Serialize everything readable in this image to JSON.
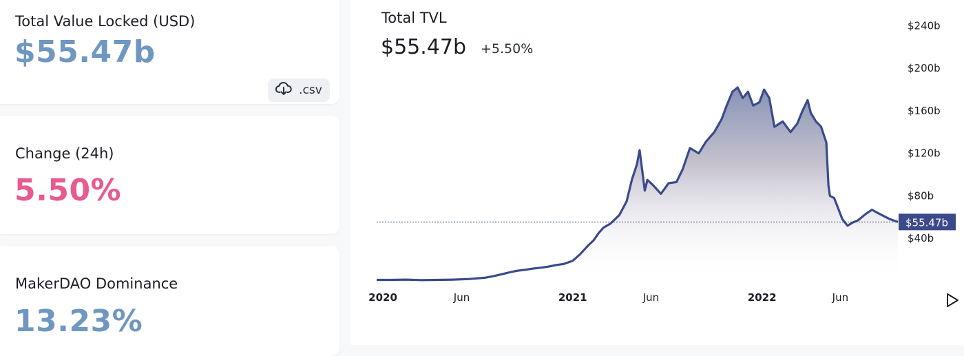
{
  "stats": [
    {
      "label": "Total Value Locked (USD)",
      "value": "$55.47b"
    },
    {
      "label": "Change (24h)",
      "value": "5.50%"
    },
    {
      "label": "MakerDAO Dominance",
      "value": "13.23%"
    }
  ],
  "csv_button": {
    "label": ".csv",
    "icon": "cloud-download-icon"
  },
  "header": {
    "title": "Total TVL",
    "value": "$55.47b",
    "change": "+5.50%"
  },
  "colors": {
    "line": "#3b4a8a",
    "accent_blue": "#6f98c0",
    "accent_pink": "#e85a92",
    "current_tag_bg": "#3b4a8a"
  },
  "chart_data": {
    "type": "area",
    "title": "Total TVL",
    "ylim": [
      0,
      250
    ],
    "y_unit": "billions USD",
    "y_ticks": [
      40,
      80,
      120,
      160,
      200,
      240
    ],
    "y_tick_labels": [
      "$40b",
      "$80b",
      "$120b",
      "$160b",
      "$200b",
      "$240b"
    ],
    "x_ticks": [
      "2020-01-01",
      "2020-06-01",
      "2021-01-01",
      "2021-06-01",
      "2022-01-01",
      "2022-06-01"
    ],
    "x_tick_labels": [
      "2020",
      "Jun",
      "2021",
      "Jun",
      "2022",
      "Jun"
    ],
    "xlim": [
      "2019-12-20",
      "2022-09-20"
    ],
    "current": {
      "value": 55.47,
      "label": "$55.47b"
    },
    "grid": false,
    "series": [
      {
        "x": [
          "2019-12-20",
          "2020-01-15",
          "2020-02-15",
          "2020-03-15",
          "2020-04-15",
          "2020-05-15",
          "2020-06-15",
          "2020-07-15",
          "2020-08-01",
          "2020-08-15",
          "2020-09-01",
          "2020-09-15",
          "2020-10-01",
          "2020-10-15",
          "2020-11-01",
          "2020-11-15",
          "2020-12-01",
          "2020-12-15",
          "2021-01-01",
          "2021-01-15",
          "2021-02-01",
          "2021-02-10",
          "2021-02-20",
          "2021-03-01",
          "2021-03-15",
          "2021-04-01",
          "2021-04-15",
          "2021-04-25",
          "2021-05-05",
          "2021-05-10",
          "2021-05-20",
          "2021-05-25",
          "2021-06-05",
          "2021-06-20",
          "2021-07-05",
          "2021-07-20",
          "2021-08-01",
          "2021-08-15",
          "2021-09-01",
          "2021-09-15",
          "2021-10-01",
          "2021-10-15",
          "2021-10-25",
          "2021-11-05",
          "2021-11-15",
          "2021-11-25",
          "2021-12-05",
          "2021-12-15",
          "2021-12-27",
          "2022-01-05",
          "2022-01-15",
          "2022-01-25",
          "2022-02-10",
          "2022-02-25",
          "2022-03-10",
          "2022-03-20",
          "2022-03-30",
          "2022-04-05",
          "2022-04-15",
          "2022-04-25",
          "2022-05-05",
          "2022-05-09",
          "2022-05-12",
          "2022-05-20",
          "2022-06-05",
          "2022-06-15",
          "2022-06-25",
          "2022-07-05",
          "2022-07-20",
          "2022-08-01",
          "2022-08-12",
          "2022-08-20",
          "2022-09-05",
          "2022-09-20"
        ],
        "y": [
          1.0,
          1.0,
          1.2,
          0.8,
          1.0,
          1.2,
          1.8,
          3.0,
          4.5,
          6.0,
          8.0,
          9.5,
          10.5,
          11.5,
          12.5,
          13.5,
          15.0,
          16.0,
          19.0,
          25.0,
          34.0,
          38.0,
          45.0,
          50.0,
          54.0,
          62.0,
          75.0,
          95.0,
          110.0,
          123.0,
          85.0,
          95.0,
          90.0,
          82.0,
          92.0,
          93.0,
          105.0,
          125.0,
          120.0,
          131.0,
          140.0,
          152.0,
          165.0,
          178.0,
          182.0,
          172.0,
          178.0,
          165.0,
          168.0,
          180.0,
          172.0,
          145.0,
          150.0,
          140.0,
          148.0,
          160.0,
          170.0,
          158.0,
          150.0,
          145.0,
          130.0,
          90.0,
          80.0,
          78.0,
          58.0,
          52.0,
          55.0,
          57.0,
          63.0,
          67.0,
          64.0,
          62.0,
          58.0,
          55.47
        ]
      }
    ]
  }
}
